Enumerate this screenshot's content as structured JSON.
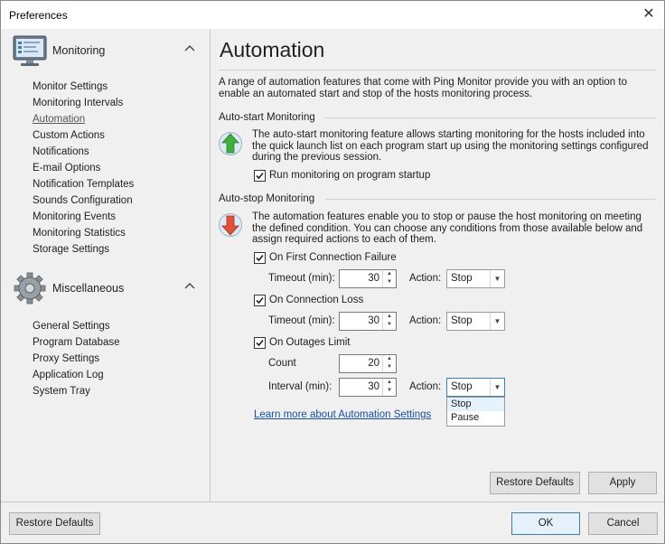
{
  "window": {
    "title": "Preferences",
    "close_glyph": "✕"
  },
  "sidebar": {
    "groups": [
      {
        "label": "Monitoring",
        "icon": "monitor-icon",
        "items": [
          "Monitor Settings",
          "Monitoring Intervals",
          "Automation",
          "Custom Actions",
          "Notifications",
          "E-mail Options",
          "Notification Templates",
          "Sounds Configuration",
          "Monitoring Events",
          "Monitoring Statistics",
          "Storage Settings"
        ],
        "active": "Automation"
      },
      {
        "label": "Miscellaneous",
        "icon": "gear-icon",
        "items": [
          "General Settings",
          "Program Database",
          "Proxy Settings",
          "Application Log",
          "System Tray"
        ]
      }
    ]
  },
  "main": {
    "title": "Automation",
    "intro": "A range of automation features that come with Ping Monitor provide you with an option to enable an automated start and stop of the hosts monitoring process.",
    "autostart": {
      "heading": "Auto-start Monitoring",
      "description": "The auto-start monitoring feature allows starting monitoring for the hosts included into the quick launch list on each program start up using the monitoring settings configured during the previous session.",
      "checkbox_label": "Run monitoring on program startup",
      "checked": true
    },
    "autostop": {
      "heading": "Auto-stop Monitoring",
      "description": "The automation features enable you to stop or pause the host monitoring on meeting the defined condition. You can choose any conditions from those available below and assign required actions to each of them.",
      "first_failure": {
        "label": "On First Connection Failure",
        "checked": true,
        "timeout_label": "Timeout (min):",
        "timeout": "30",
        "action_label": "Action:",
        "action": "Stop"
      },
      "connection_loss": {
        "label": "On Connection Loss",
        "checked": true,
        "timeout_label": "Timeout (min):",
        "timeout": "30",
        "action_label": "Action:",
        "action": "Stop"
      },
      "outages": {
        "label": "On Outages Limit",
        "checked": true,
        "count_label": "Count",
        "count": "20",
        "interval_label": "Interval (min):",
        "interval": "30",
        "action_label": "Action:",
        "action": "Stop",
        "options": [
          "Stop",
          "Pause"
        ]
      }
    },
    "learn_more": "Learn more about Automation Settings",
    "restore_defaults": "Restore Defaults",
    "apply": "Apply"
  },
  "footer": {
    "restore_defaults": "Restore Defaults",
    "ok": "OK",
    "cancel": "Cancel"
  },
  "colors": {
    "accent": "#3c7fb1",
    "link": "#1a4fa0",
    "arrow_up": "#3fae3f",
    "arrow_down": "#e0533a"
  }
}
